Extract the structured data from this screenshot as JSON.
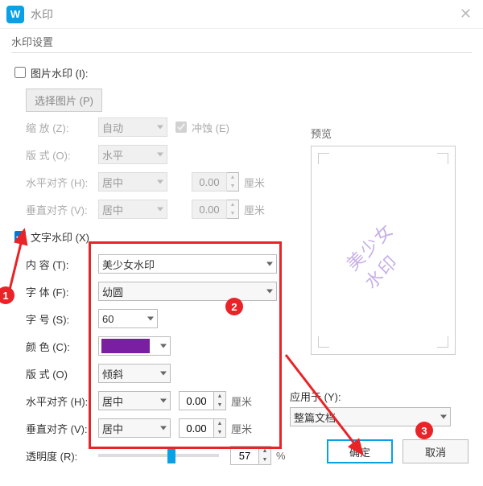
{
  "titlebar": {
    "title": "水印"
  },
  "group": {
    "title": "水印设置"
  },
  "img_wm": {
    "checkbox_label": "图片水印 (I):",
    "select_btn": "选择图片 (P)",
    "scale_label": "缩  放 (Z):",
    "scale_value": "自动",
    "wash_label": "冲蚀 (E)",
    "layout_label": "版  式 (O):",
    "layout_value": "水平",
    "halign_label": "水平对齐 (H):",
    "halign_value": "居中",
    "halign_num": "0.00",
    "valign_label": "垂直对齐 (V):",
    "valign_value": "居中",
    "valign_num": "0.00",
    "unit": "厘米"
  },
  "txt_wm": {
    "checkbox_label": "文字水印 (X)",
    "content_label": "内  容 (T):",
    "content_value": "美少女水印",
    "font_label": "字  体 (F):",
    "font_value": "幼圆",
    "size_label": "字  号 (S):",
    "size_value": "60",
    "color_label": "颜  色 (C):",
    "color_value": "#7a1fa2",
    "layout_label": "版  式 (O)",
    "layout_value": "倾斜",
    "halign_label": "水平对齐 (H):",
    "halign_value": "居中",
    "halign_num": "0.00",
    "valign_label": "垂直对齐 (V):",
    "valign_value": "居中",
    "valign_num": "0.00",
    "unit": "厘米",
    "opacity_label": "透明度 (R):",
    "opacity_value": "57",
    "opacity_pct": "%"
  },
  "preview": {
    "title": "预览",
    "text": "美少女水印"
  },
  "apply": {
    "label": "应用于 (Y):",
    "value": "整篇文档"
  },
  "buttons": {
    "ok": "确定",
    "cancel": "取消"
  },
  "badges": {
    "b1": "1",
    "b2": "2",
    "b3": "3"
  }
}
